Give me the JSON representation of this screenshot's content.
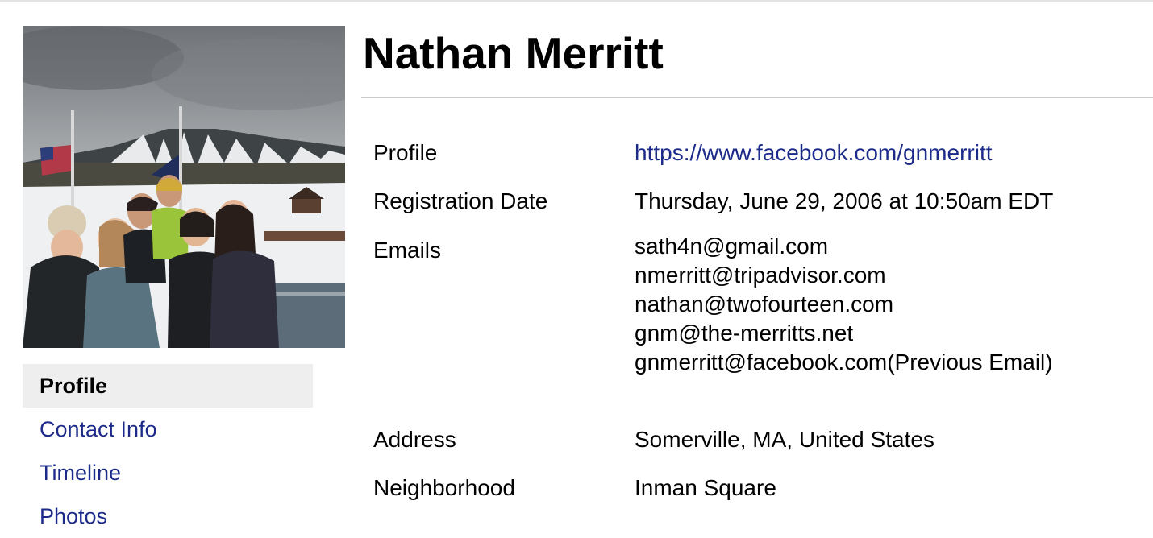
{
  "profile": {
    "name": "Nathan Merritt",
    "photo_alt": "profile-photo"
  },
  "nav": {
    "items": [
      {
        "label": "Profile",
        "active": true
      },
      {
        "label": "Contact Info",
        "active": false
      },
      {
        "label": "Timeline",
        "active": false
      },
      {
        "label": "Photos",
        "active": false
      }
    ]
  },
  "info": {
    "profile_label": "Profile",
    "profile_url": "https://www.facebook.com/gnmerritt",
    "registration_label": "Registration Date",
    "registration_value": "Thursday, June 29, 2006 at 10:50am EDT",
    "emails_label": "Emails",
    "emails": [
      "sath4n@gmail.com",
      "nmerritt@tripadvisor.com",
      "nathan@twofourteen.com",
      "gnm@the-merritts.net",
      "gnmerritt@facebook.com(Previous Email)"
    ],
    "address_label": "Address",
    "address_value": "Somerville, MA, United States",
    "neighborhood_label": "Neighborhood",
    "neighborhood_value": "Inman Square"
  },
  "colors": {
    "link": "#1c2a8a",
    "active_nav_bg": "#eeeeee",
    "rule": "#cccccc"
  }
}
